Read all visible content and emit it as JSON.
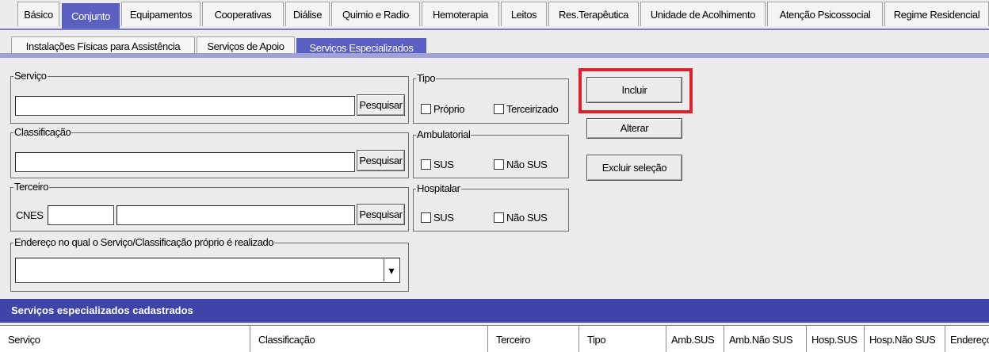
{
  "tabs_main": [
    "Básico",
    "Conjunto",
    "Equipamentos",
    "Cooperativas",
    "Diálise",
    "Quimio e Radio",
    "Hemoterapia",
    "Leitos",
    "Res.Terapêutica",
    "Unidade de Acolhimento",
    "Atenção Psicossocial",
    "Regime Residencial"
  ],
  "tabs_sub": [
    "Instalações Físicas para Assistência",
    "Serviços de Apoio",
    "Serviços Especializados"
  ],
  "servico": {
    "legend": "Serviço",
    "value": "",
    "search_label": "Pesquisar"
  },
  "classificacao": {
    "legend": "Classificação",
    "value": "",
    "search_label": "Pesquisar"
  },
  "terceiro": {
    "legend": "Terceiro",
    "cnes_label": "CNES",
    "cnes_value": "",
    "name_value": "",
    "search_label": "Pesquisar"
  },
  "endereco": {
    "legend": "Endereço no qual o Serviço/Classificação próprio é realizado",
    "selected": "",
    "arrow": "▾"
  },
  "tipo": {
    "legend": "Tipo",
    "proprio": "Próprio",
    "terceirizado": "Terceirizado"
  },
  "ambulatorial": {
    "legend": "Ambulatorial",
    "sus": "SUS",
    "nao_sus": "Não SUS"
  },
  "hospitalar": {
    "legend": "Hospitalar",
    "sus": "SUS",
    "nao_sus": "Não SUS"
  },
  "actions": {
    "incluir": "Incluir",
    "alterar": "Alterar",
    "excluir": "Excluir seleção"
  },
  "list": {
    "title": "Serviços especializados cadastrados",
    "columns": [
      "Serviço",
      "Classificação",
      "Terceiro",
      "Tipo",
      "Amb.SUS",
      "Amb.Não SUS",
      "Hosp.SUS",
      "Hosp.Não SUS",
      "Endereço"
    ]
  },
  "colors": {
    "accent": "#5b5fc0",
    "list_header": "#3f44a8",
    "highlight": "#e0202a"
  }
}
